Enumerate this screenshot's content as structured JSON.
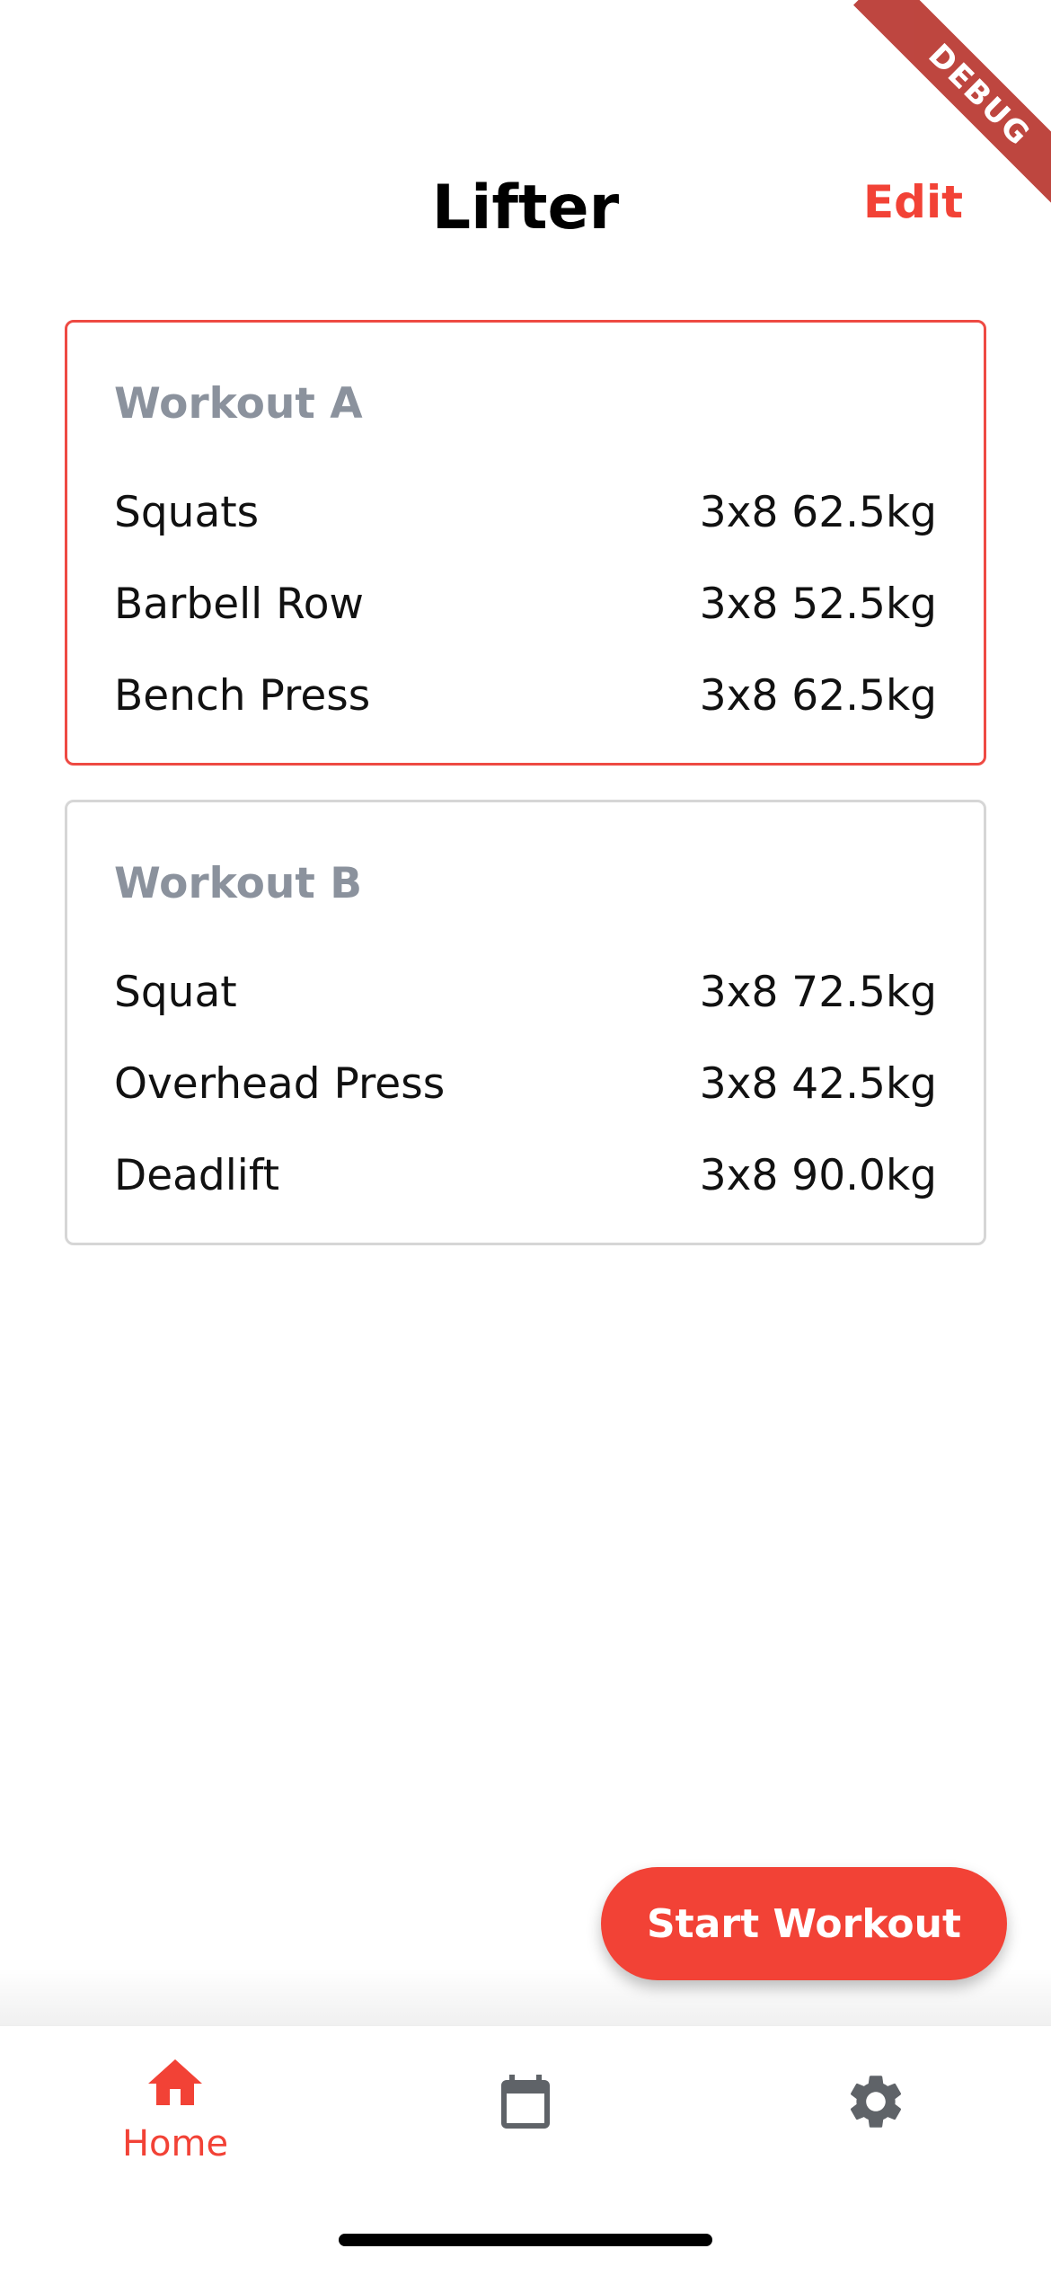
{
  "debug_banner": "DEBUG",
  "header": {
    "title": "Lifter",
    "edit_label": "Edit"
  },
  "workouts": [
    {
      "title": "Workout A",
      "selected": true,
      "exercises": [
        {
          "name": "Squats",
          "detail": "3x8 62.5kg"
        },
        {
          "name": "Barbell Row",
          "detail": "3x8 52.5kg"
        },
        {
          "name": "Bench Press",
          "detail": "3x8 62.5kg"
        }
      ]
    },
    {
      "title": "Workout B",
      "selected": false,
      "exercises": [
        {
          "name": "Squat",
          "detail": "3x8 72.5kg"
        },
        {
          "name": "Overhead Press",
          "detail": "3x8 42.5kg"
        },
        {
          "name": "Deadlift",
          "detail": "3x8 90.0kg"
        }
      ]
    }
  ],
  "fab": {
    "label": "Start Workout"
  },
  "bottom_nav": {
    "items": [
      {
        "icon": "home-icon",
        "label": "Home",
        "active": true
      },
      {
        "icon": "calendar-icon",
        "label": "",
        "active": false
      },
      {
        "icon": "gear-icon",
        "label": "",
        "active": false
      }
    ]
  },
  "colors": {
    "accent": "#f24236",
    "card_border": "#d6d6d6",
    "card_title": "#8b929d",
    "inactive_icon": "#5f6368"
  }
}
